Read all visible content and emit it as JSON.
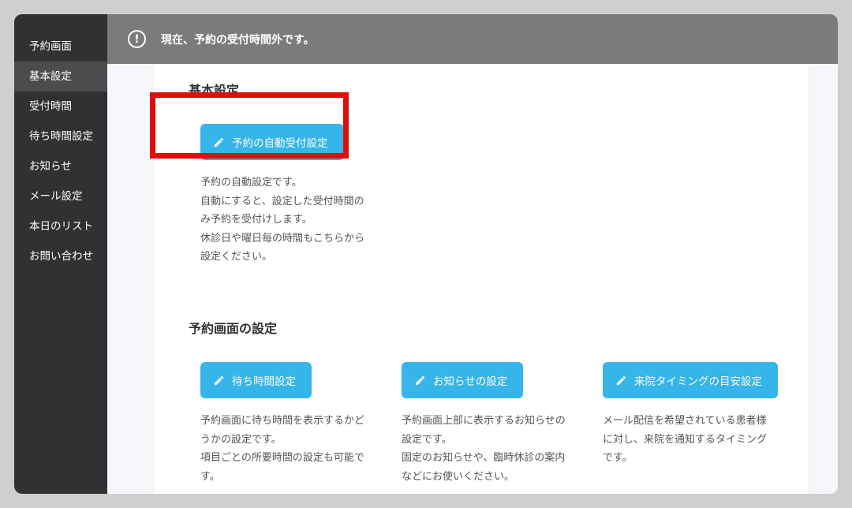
{
  "sidebar": {
    "items": [
      {
        "label": "予約画面"
      },
      {
        "label": "基本設定"
      },
      {
        "label": "受付時間"
      },
      {
        "label": "待ち時間設定"
      },
      {
        "label": "お知らせ"
      },
      {
        "label": "メール設定"
      },
      {
        "label": "本日のリスト"
      },
      {
        "label": "お問い合わせ"
      }
    ],
    "active_item": "基本設定"
  },
  "alert": {
    "icon": "exclamation-circle-icon",
    "text": "現在、予約の受付時間外です。"
  },
  "basic": {
    "title": "基本設定",
    "auto_button": {
      "label": "予約の自動受付設定",
      "icon": "pencil-icon",
      "desc": [
        "予約の自動設定です。",
        "自動にすると、設定した受付時間の",
        "み予約を受付けします。",
        "休診日や曜日毎の時間もこちらから",
        "設定ください。"
      ]
    }
  },
  "reservation": {
    "title": "予約画面の設定",
    "buttons": [
      {
        "label": "待ち時間設定",
        "icon": "pencil-icon",
        "desc": [
          "予約画面に待ち時間を表示するかど",
          "うかの設定です。",
          "項目ごとの所要時間の設定も可能で",
          "す。"
        ]
      },
      {
        "label": "お知らせの設定",
        "icon": "pencil-icon",
        "desc": [
          "予約画面上部に表示するお知らせの",
          "設定です。",
          "固定のお知らせや、臨時休診の案内",
          "などにお使いください。"
        ]
      },
      {
        "label": "来院タイミングの目安設定",
        "icon": "pencil-icon",
        "desc": [
          "メール配信を希望されている患者様",
          "に対し、来院を通知するタイミング",
          "です。"
        ]
      }
    ]
  },
  "colors": {
    "sidebar_bg": "#2f3133",
    "topbar_bg": "#7b7b7b",
    "button_bg": "#36b5ea",
    "highlight_border": "#e00d0d"
  }
}
